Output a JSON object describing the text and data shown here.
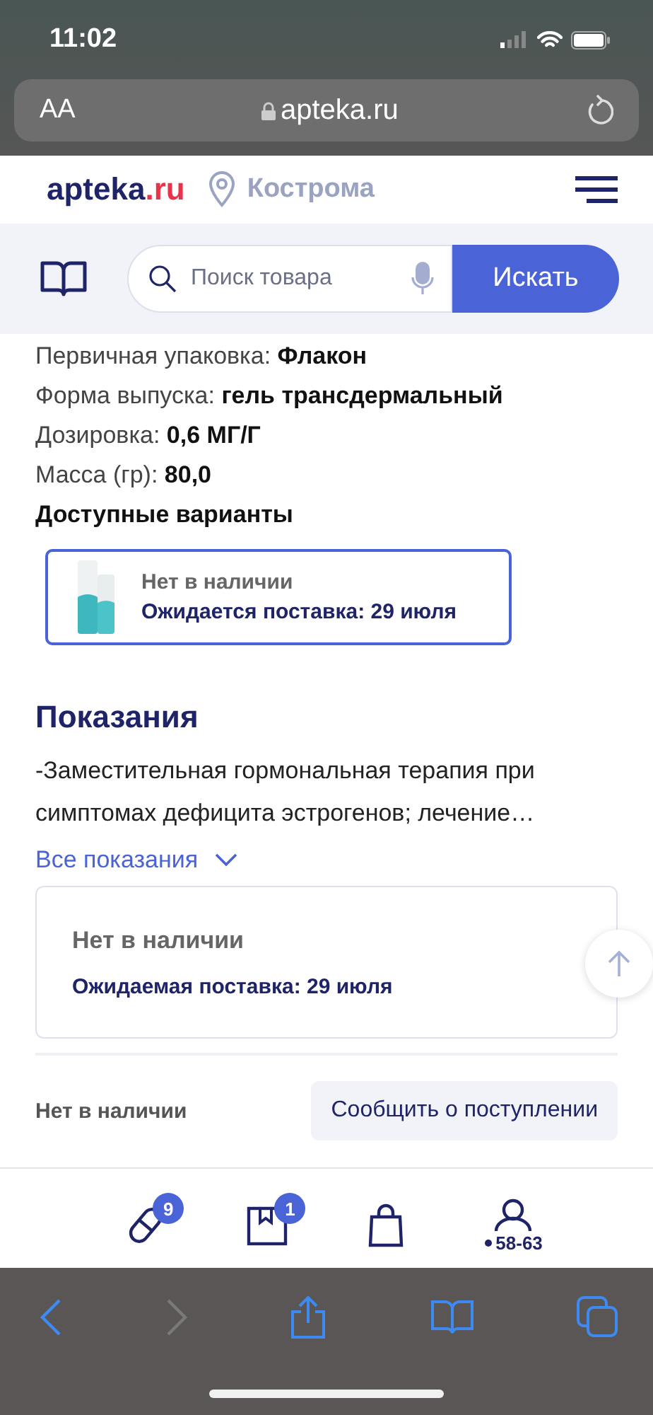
{
  "status_bar": {
    "time": "11:02"
  },
  "browser": {
    "text_size": "AA",
    "address": "apteka.ru"
  },
  "header": {
    "logo": "apteka",
    "logo_suffix": ".ru",
    "city": "Кострома"
  },
  "search": {
    "placeholder": "Поиск товара",
    "button": "Искать"
  },
  "specs": [
    {
      "label": "Первичная упаковка:",
      "value": "Флакон"
    },
    {
      "label": "Форма выпуска:",
      "value": "гель трансдермальный"
    },
    {
      "label": "Дозировка:",
      "value": "0,6 МГ/Г"
    },
    {
      "label": "Масса (гр):",
      "value": "80,0"
    }
  ],
  "variants_title": "Доступные варианты",
  "variants": [
    {
      "status": "Нет в наличии",
      "delivery": "Ожидается поставка: 29 июля",
      "selected": true
    }
  ],
  "indications": {
    "title": "Показания",
    "text": "-Заместительная гормональная терапия при симптомах дефицита эстрогенов; лечение…",
    "more_link": "Все показания"
  },
  "availability": {
    "status": "Нет в наличии",
    "delivery_label": "Ожидаемая поставка:",
    "delivery_date": "29 июля"
  },
  "action_bar": {
    "status": "Нет в наличии",
    "button": "Сообщить о поступлении"
  },
  "bottom_nav": [
    {
      "kind": "pills",
      "badge": "9"
    },
    {
      "kind": "box",
      "badge": "1"
    },
    {
      "kind": "bag"
    },
    {
      "kind": "profile",
      "label": "58-63"
    }
  ]
}
